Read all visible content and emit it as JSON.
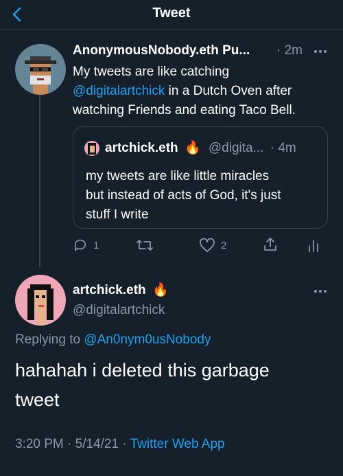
{
  "header": {
    "title": "Tweet"
  },
  "parent_tweet": {
    "display_name": "AnonymousNobody.eth Pu...",
    "time": "· 2m",
    "text_before_mention": "My tweets are like catching",
    "mention": "@digitalartchick",
    "text_after_mention": " in a Dutch Oven after",
    "text_line3": "watching Friends and eating Taco Bell.",
    "quote": {
      "display_name": "artchick.eth",
      "emoji": "🔥",
      "handle": "@digita...",
      "time": "· 4m",
      "line1": "my tweets are like little miracles",
      "line2": "but instead of acts of God, it's just",
      "line3": "stuff I write"
    },
    "actions": {
      "replies": "1",
      "likes": "2"
    }
  },
  "main_tweet": {
    "display_name": "artchick.eth",
    "emoji": "🔥",
    "handle": "@digitalartchick",
    "replying_label": "Replying to",
    "replying_handle": "@An0nym0usNobody",
    "line1": "hahahah i deleted this garbage",
    "line2": "tweet",
    "time": "3:20 PM",
    "date": "5/14/21",
    "source": "Twitter Web App",
    "sep1": "·",
    "sep2": "·"
  },
  "colors": {
    "background": "#15202b",
    "accent": "#1da1f2",
    "muted": "#8899a6",
    "border": "#38444d"
  }
}
